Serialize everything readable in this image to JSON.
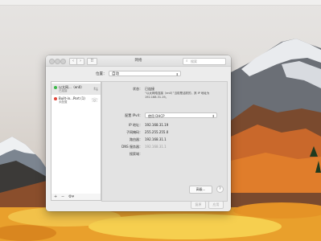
{
  "window": {
    "title": "网络",
    "search_placeholder": "搜索",
    "nav_back": "‹",
    "nav_forward": "›",
    "grid_icon": "⠿"
  },
  "location": {
    "label": "位置：",
    "value": "自动"
  },
  "services": [
    {
      "name": "以太网...（en0）",
      "status": "已连接",
      "color": "#3cb84a",
      "icon": "arrows-icon"
    },
    {
      "name": "Built-in...Port (1)",
      "status": "未配置",
      "color": "#e0473b",
      "icon": "phone-icon"
    }
  ],
  "sidebar_footer": {
    "add": "+",
    "remove": "−",
    "more": "⚙▾"
  },
  "detail": {
    "status_label": "状态：",
    "status_value": "已连接",
    "status_note": "“以太网络连接（en0）”当前是活跃的，其 IP 地址为 192.168.31.19。",
    "config_label": "配置 IPv4：",
    "config_value": "使用 DHCP",
    "ip_label": "IP 地址：",
    "ip_value": "192.168.31.19",
    "mask_label": "子网掩码：",
    "mask_value": "255.255.255.0",
    "router_label": "路由器：",
    "router_value": "192.168.31.1",
    "dns_label": "DNS 服务器：",
    "dns_value": "192.168.31.1",
    "search_domain_label": "搜索域：",
    "advanced_button": "高级...",
    "help_button": "?"
  },
  "footer": {
    "revert": "复原",
    "apply": "应用"
  }
}
